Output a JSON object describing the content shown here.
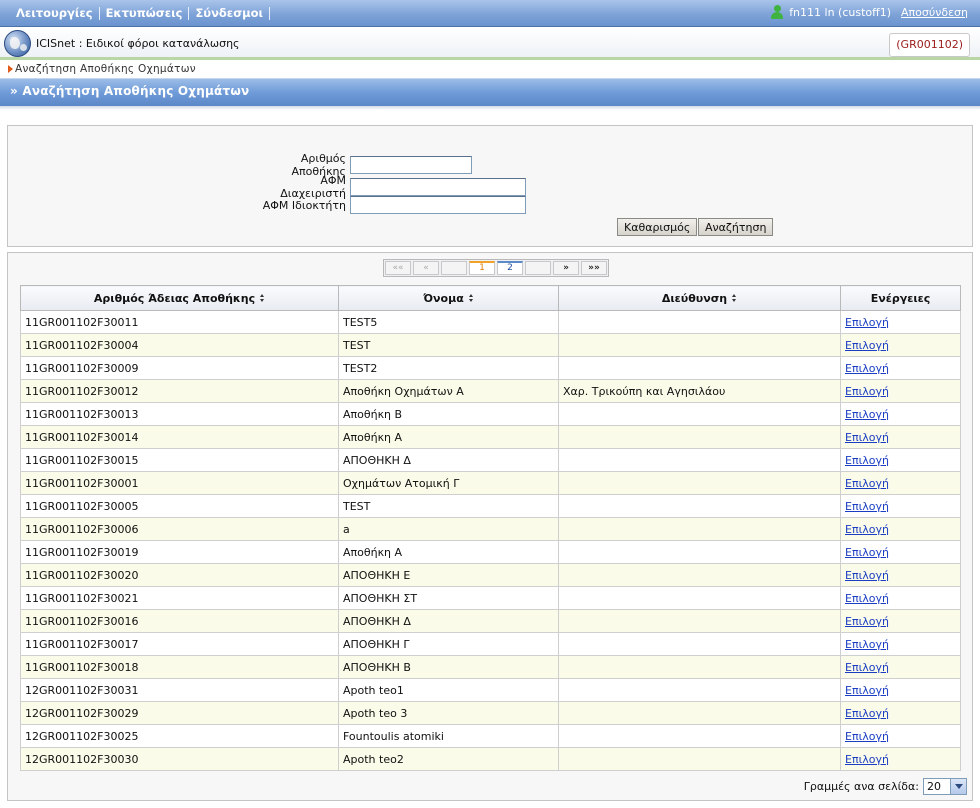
{
  "topmenu": {
    "items": [
      "Λειτουργίες",
      "Εκτυπώσεις",
      "Σύνδεσμοι"
    ],
    "user": "fn111 ln (custoff1)",
    "logout": "Αποσύνδεση"
  },
  "app": {
    "title": "ICISnet : Ειδικοί φόροι κατανάλωσης",
    "code": "(GR001102)"
  },
  "breadcrumb": "Αναζήτηση Αποθήκης Οχημάτων",
  "page_title": "» Αναζήτηση Αποθήκης Οχημάτων",
  "search": {
    "fields": [
      {
        "label": "Αριθμός Αποθήκης",
        "value": ""
      },
      {
        "label": "ΑΦΜ Διαχειριστή",
        "value": ""
      },
      {
        "label": "ΑΦΜ Ιδιοκτήτη",
        "value": ""
      }
    ],
    "clear_label": "Καθαρισμός",
    "search_label": "Αναζήτηση"
  },
  "pager": {
    "first": "«« ",
    "prev": "«",
    "pages": [
      "1",
      "2"
    ],
    "current": "1",
    "next": "»",
    "last": "»»"
  },
  "table": {
    "columns": [
      "Αριθμός Άδειας Αποθήκης",
      "Όνομα",
      "Διεύθυνση",
      "Ενέργειες"
    ],
    "action_label": "Επιλογή",
    "rows": [
      [
        "11GR001102F30011",
        "TEST5",
        ""
      ],
      [
        "11GR001102F30004",
        "TEST",
        ""
      ],
      [
        "11GR001102F30009",
        "TEST2",
        ""
      ],
      [
        "11GR001102F30012",
        "Αποθήκη Οχημάτων Α",
        "Χαρ. Τρικούπη και Αγησιλάου"
      ],
      [
        "11GR001102F30013",
        "Αποθήκη Β",
        ""
      ],
      [
        "11GR001102F30014",
        "Αποθήκη Α",
        ""
      ],
      [
        "11GR001102F30015",
        "ΑΠΟΘΗΚΗ Δ",
        ""
      ],
      [
        "11GR001102F30001",
        "Οχημάτων Ατομική Γ",
        ""
      ],
      [
        "11GR001102F30005",
        "TEST",
        ""
      ],
      [
        "11GR001102F30006",
        "a",
        ""
      ],
      [
        "11GR001102F30019",
        "Αποθήκη Α",
        ""
      ],
      [
        "11GR001102F30020",
        "ΑΠΟΘΗΚΗ Ε",
        ""
      ],
      [
        "11GR001102F30021",
        "ΑΠΟΘΗΚΗ ΣΤ",
        ""
      ],
      [
        "11GR001102F30016",
        "ΑΠΟΘΗΚΗ Δ",
        ""
      ],
      [
        "11GR001102F30017",
        "ΑΠΟΘΗΚΗ Γ",
        ""
      ],
      [
        "11GR001102F30018",
        "ΑΠΟΘΗΚΗ Β",
        ""
      ],
      [
        "12GR001102F30031",
        "Apoth teo1",
        ""
      ],
      [
        "12GR001102F30029",
        "Apoth teo 3",
        ""
      ],
      [
        "12GR001102F30025",
        "Fountoulis atomiki",
        ""
      ],
      [
        "12GR001102F30030",
        "Apoth teo2",
        ""
      ]
    ]
  },
  "rows_per_page": {
    "label": "Γραμμές ανα σελίδα:",
    "value": "20"
  },
  "colors": {
    "accent": "#6f9bd8",
    "link": "#1a3dc2",
    "badge_text": "#9b1b1b",
    "alt_row": "#fbfbe9"
  }
}
